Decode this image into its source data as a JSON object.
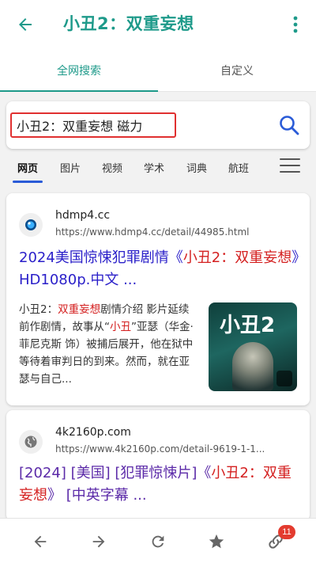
{
  "app": {
    "title": "小丑2：双重妄想"
  },
  "tabs": [
    {
      "label": "全网搜索",
      "active": true
    },
    {
      "label": "自定义",
      "active": false
    }
  ],
  "search": {
    "query": "小丑2：双重妄想 磁力"
  },
  "categories": [
    "网页",
    "图片",
    "视频",
    "学术",
    "词典",
    "航班"
  ],
  "results": [
    {
      "site": "hdmp4.cc",
      "url": "https://www.hdmp4.cc/detail/44985.html",
      "title_pre": "2024美国惊悚犯罪剧情《",
      "title_hl": "小丑2：双重妄想",
      "title_post": "》HD1080p.中文 ...",
      "snippet_pre": "小丑2：",
      "snippet_hl1": "双重妄想",
      "snippet_mid": "剧情介绍 影片延续前作剧情，故事从“",
      "snippet_hl2": "小丑",
      "snippet_post": "”亚瑟（华金·菲尼克斯 饰）被捕后展开，他在狱中等待着审判日的到来。然而，就在亚瑟与自己...",
      "thumb_text": "小丑2"
    },
    {
      "site": "4k2160p.com",
      "url": "https://www.4k2160p.com/detail-9619-1-1...",
      "title_pre": "[2024] [美国] [犯罪惊悚片]《",
      "title_hl": "小丑2：双重妄想",
      "title_post": "》 [中英字幕 ..."
    }
  ],
  "bottom": {
    "tabs_count": "11"
  },
  "colors": {
    "accent": "#1e9a8a",
    "link": "#2a1fc9",
    "highlight": "#d42020",
    "search_border": "#e03030"
  }
}
